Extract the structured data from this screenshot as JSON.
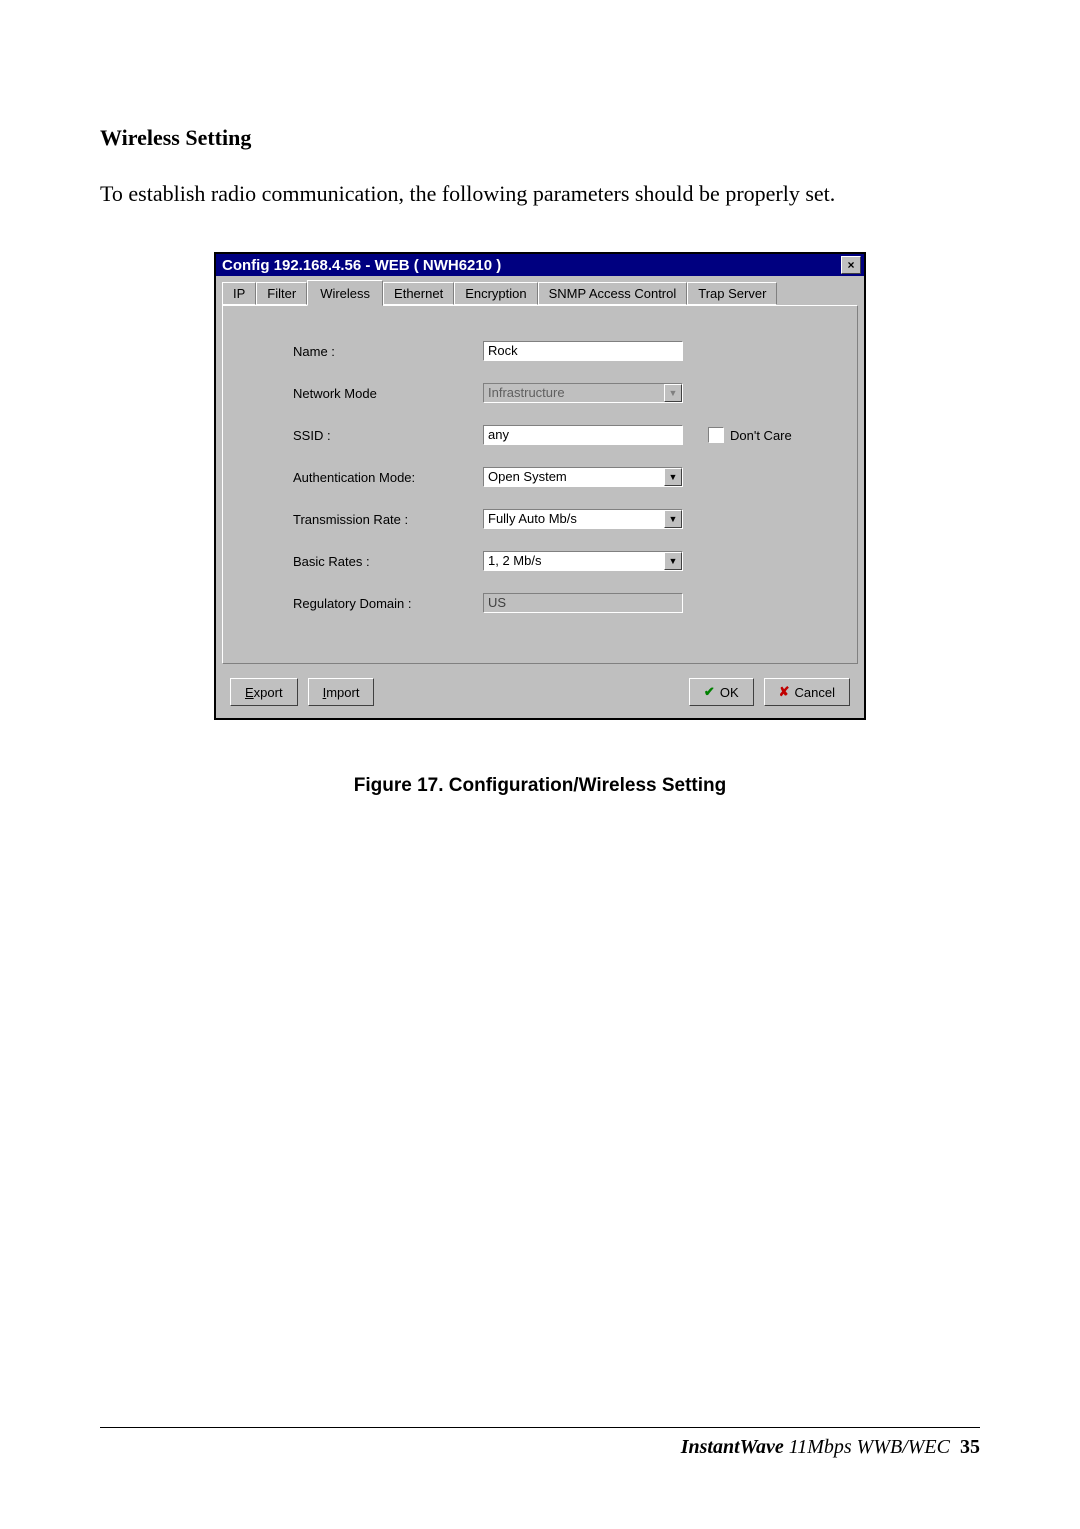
{
  "section_heading": "Wireless Setting",
  "intro_text": "To establish radio communication, the following parameters should be properly set.",
  "dialog": {
    "title": "Config 192.168.4.56 - WEB ( NWH6210 )",
    "tabs": [
      "IP",
      "Filter",
      "Wireless",
      "Ethernet",
      "Encryption",
      "SNMP Access Control",
      "Trap Server"
    ],
    "active_tab_index": 2,
    "fields": {
      "name_label": "Name :",
      "name_value": "Rock",
      "network_mode_label": "Network Mode",
      "network_mode_value": "Infrastructure",
      "ssid_label": "SSID :",
      "ssid_value": "any",
      "dont_care_label": "Don't Care",
      "auth_mode_label": "Authentication Mode:",
      "auth_mode_value": "Open System",
      "tx_rate_label": "Transmission Rate :",
      "tx_rate_value": "Fully Auto Mb/s",
      "basic_rates_label": "Basic Rates :",
      "basic_rates_value": "1, 2 Mb/s",
      "reg_domain_label": "Regulatory Domain :",
      "reg_domain_value": "US"
    },
    "buttons": {
      "export": "Export",
      "import": "Import",
      "ok": "OK",
      "cancel": "Cancel"
    }
  },
  "figure_caption": "Figure 17.    Configuration/Wireless Setting",
  "footer": {
    "brand_bold": "InstantWave",
    "brand_rest": " 11Mbps WWB/WEC",
    "page_number": "35"
  }
}
